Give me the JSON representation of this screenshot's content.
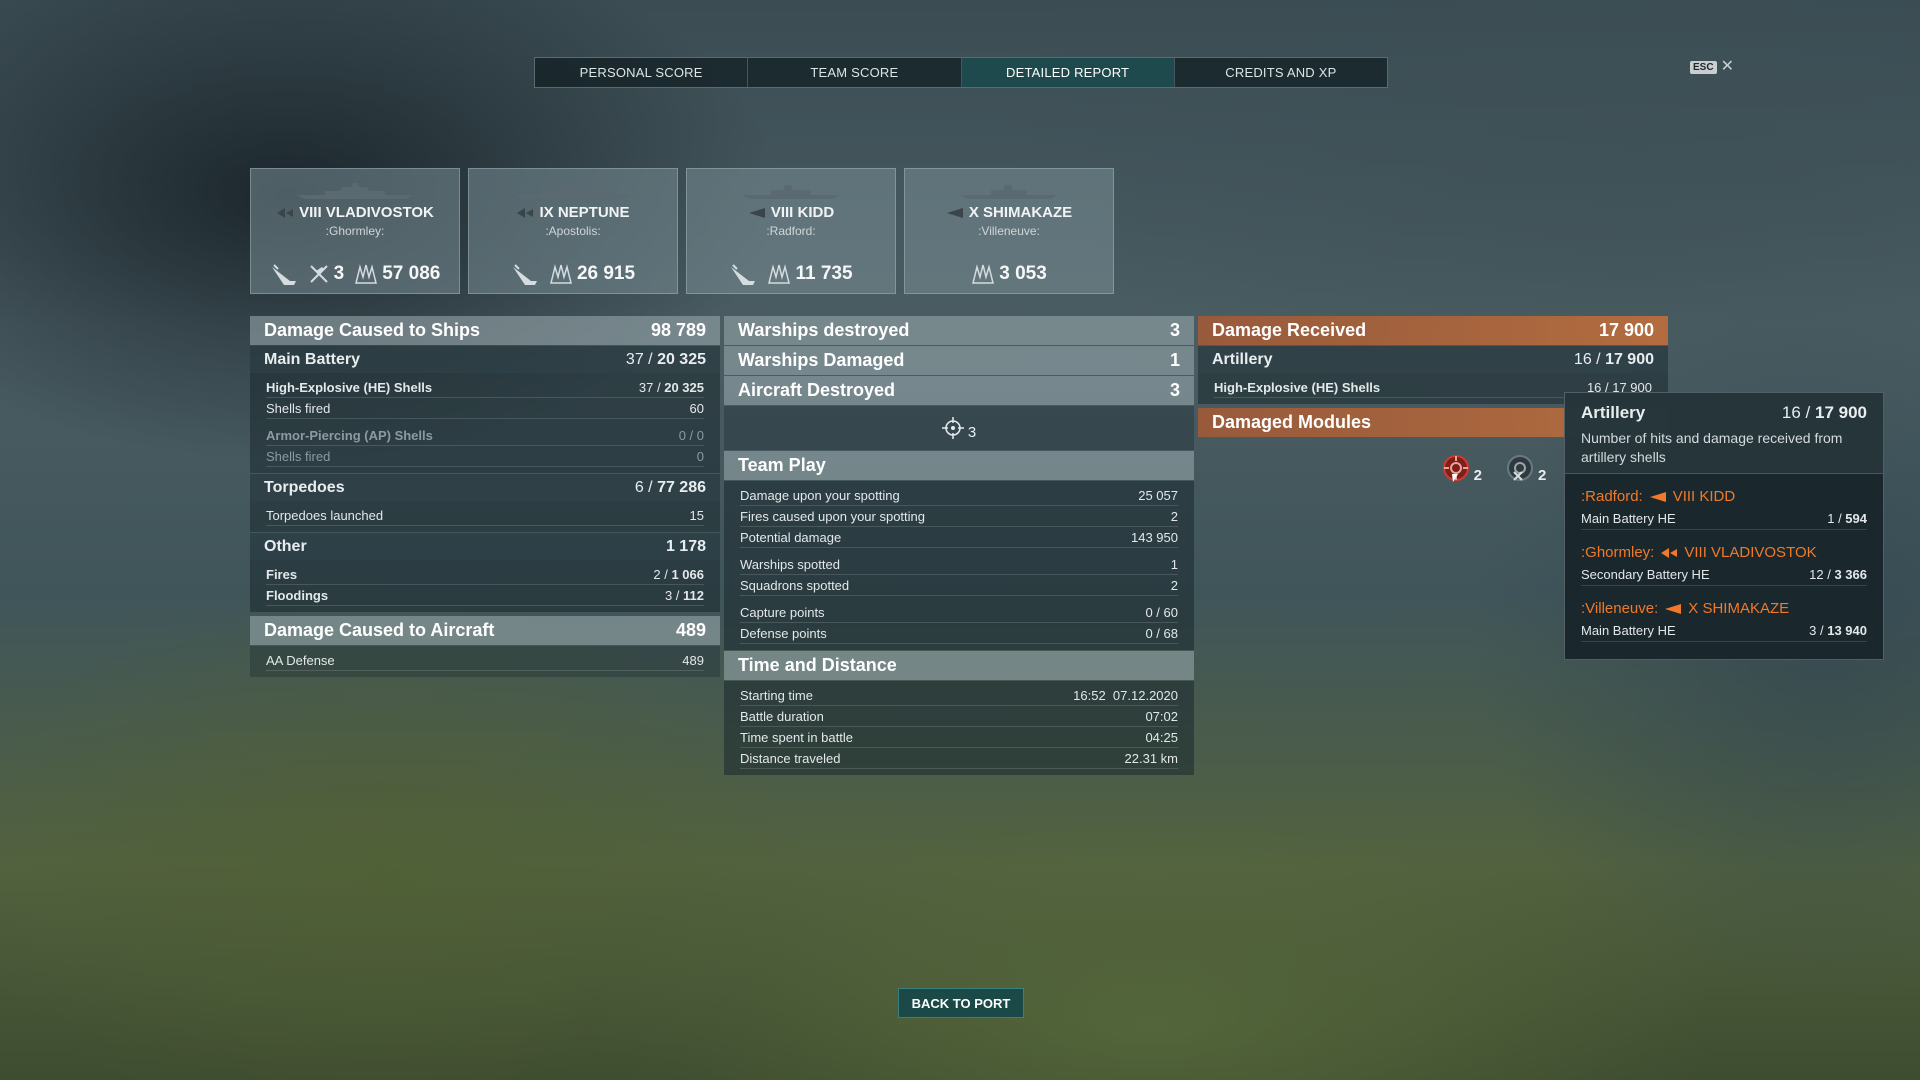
{
  "nav": {
    "tabs": [
      {
        "label": "PERSONAL SCORE"
      },
      {
        "label": "TEAM SCORE"
      },
      {
        "label": "DETAILED REPORT"
      },
      {
        "label": "CREDITS AND XP"
      }
    ],
    "active_tab": "DETAILED REPORT",
    "esc_label": "ESC",
    "close_glyph": "✕"
  },
  "ships": [
    {
      "tier_name": "VIII VLADIVOSTOK",
      "player": ":Ghormley:",
      "planes_killed": "3",
      "damage": "57 086"
    },
    {
      "tier_name": "IX NEPTUNE",
      "player": ":Apostolis:",
      "damage": "26 915"
    },
    {
      "tier_name": "VIII KIDD",
      "player": ":Radford:",
      "damage": "11 735"
    },
    {
      "tier_name": "X SHIMAKAZE",
      "player": ":Villeneuve:",
      "damage": "3 053"
    }
  ],
  "left": {
    "damage_ships": {
      "label": "Damage Caused to Ships",
      "value": "98 789"
    },
    "main_battery": {
      "label": "Main Battery",
      "hits": "37",
      "sep": " / ",
      "damage": "20 325"
    },
    "he": {
      "label": "High-Explosive (HE) Shells",
      "hits": "37",
      "sep": " / ",
      "damage": "20 325"
    },
    "he_fired": {
      "label": "Shells fired",
      "value": "60"
    },
    "ap": {
      "label": "Armor-Piercing (AP) Shells",
      "value": "0 / 0"
    },
    "ap_fired": {
      "label": "Shells fired",
      "value": "0"
    },
    "torpedoes": {
      "label": "Torpedoes",
      "hits": "6",
      "sep": " / ",
      "damage": "77 286"
    },
    "torp_launched": {
      "label": "Torpedoes launched",
      "value": "15"
    },
    "other": {
      "label": "Other",
      "value": "1 178"
    },
    "fires": {
      "label": "Fires",
      "hits": "2",
      "sep": " / ",
      "damage": "1 066"
    },
    "floodings": {
      "label": "Floodings",
      "hits": "3",
      "sep": " / ",
      "damage": "112"
    },
    "damage_aircraft": {
      "label": "Damage Caused to Aircraft",
      "value": "489"
    },
    "aa_defense": {
      "label": "AA Defense",
      "value": "489"
    }
  },
  "middle": {
    "destroyed": {
      "label": "Warships destroyed",
      "value": "3"
    },
    "damaged": {
      "label": "Warships Damaged",
      "value": "1"
    },
    "aircraft": {
      "label": "Aircraft Destroyed",
      "value": "3"
    },
    "crosshair_count": "3",
    "team_play": {
      "label": "Team Play",
      "rows": [
        {
          "label": "Damage upon your spotting",
          "value": "25 057"
        },
        {
          "label": "Fires caused upon your spotting",
          "value": "2"
        },
        {
          "label": "Potential damage",
          "value": "143 950"
        },
        {
          "label": "Warships spotted",
          "value": "1"
        },
        {
          "label": "Squadrons spotted",
          "value": "2"
        },
        {
          "label": "Capture points",
          "value": "0 / 60"
        },
        {
          "label": "Defense points",
          "value": "0 / 68"
        }
      ]
    },
    "time_distance": {
      "label": "Time and Distance",
      "rows": [
        {
          "label": "Starting time",
          "value": "16:52  07.12.2020"
        },
        {
          "label": "Battle duration",
          "value": "07:02"
        },
        {
          "label": "Time spent in battle",
          "value": "04:25"
        },
        {
          "label": "Distance traveled",
          "value": "22.31 km"
        }
      ]
    }
  },
  "right": {
    "received": {
      "label": "Damage Received",
      "value": "17 900"
    },
    "artillery": {
      "label": "Artillery",
      "hits": "16",
      "sep": " / ",
      "damage": "17 900"
    },
    "he": {
      "label": "High-Explosive (HE) Shells",
      "value": "16 / 17 900"
    },
    "modules": {
      "label": "Damaged Modules"
    },
    "module_counts": [
      "2",
      "2"
    ]
  },
  "tooltip": {
    "title": "Artillery",
    "hits": "16",
    "sep": " / ",
    "damage": "17 900",
    "desc": "Number of hits and damage received from artillery shells",
    "entries": [
      {
        "player": ":Radford:",
        "ship": "VIII KIDD",
        "weapon": "Main Battery HE",
        "hits": "1",
        "sep": " / ",
        "damage": "594"
      },
      {
        "player": ":Ghormley:",
        "ship": "VIII VLADIVOSTOK",
        "weapon": "Secondary Battery HE",
        "hits": "12",
        "sep": " / ",
        "damage": "3 366"
      },
      {
        "player": ":Villeneuve:",
        "ship": "X SHIMAKAZE",
        "weapon": "Main Battery HE",
        "hits": "3",
        "sep": " / ",
        "damage": "13 940"
      }
    ]
  },
  "footer": {
    "back_label": "BACK TO PORT"
  },
  "colors": {
    "accent_orange": "#f07a2a",
    "active_tab": "#1e5054"
  }
}
